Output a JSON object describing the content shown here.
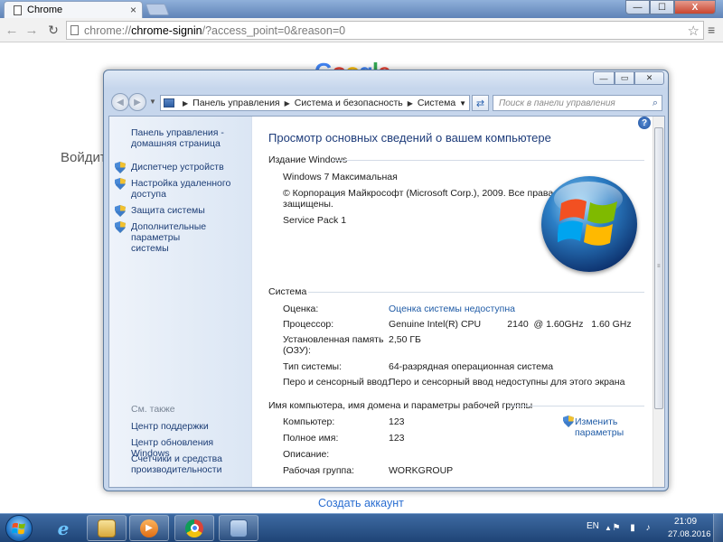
{
  "chrome": {
    "tab_title": "Chrome",
    "tab_close": "×",
    "url_scheme": "chrome://",
    "url_host": "chrome-signin",
    "url_rest": "/?access_point=0&reason=0",
    "min_glyph": "—",
    "max_glyph": "☐",
    "close_glyph": "X"
  },
  "page": {
    "signin_text": "Войдит",
    "create_account": "Создать аккаунт"
  },
  "sys_window": {
    "breadcrumb": [
      "Панель управления",
      "Система и безопасность",
      "Система"
    ],
    "search_placeholder": "Поиск в панели управления",
    "min_glyph": "—",
    "max_glyph": "▭",
    "close_glyph": "✕",
    "help_glyph": "?",
    "task_pane": {
      "home_link_line1": "Панель управления -",
      "home_link_line2": "домашняя страница",
      "links": [
        {
          "line1": "Диспетчер устройств",
          "line2": ""
        },
        {
          "line1": "Настройка удаленного",
          "line2": "доступа"
        },
        {
          "line1": "Защита системы",
          "line2": ""
        },
        {
          "line1": "Дополнительные параметры",
          "line2": "системы"
        }
      ],
      "see_also": "См. также",
      "see_also_links": [
        {
          "line1": "Центр поддержки",
          "line2": ""
        },
        {
          "line1": "Центр обновления Windows",
          "line2": ""
        },
        {
          "line1": "Счетчики и средства",
          "line2": "производительности"
        }
      ]
    },
    "main": {
      "title": "Просмотр основных сведений о вашем компьютере",
      "edition_head": "Издание Windows",
      "edition_name": "Windows 7 Максимальная",
      "copyright_line1": "© Корпорация Майкрософт (Microsoft Corp.), 2009. Все права",
      "copyright_line2": "защищены.",
      "service_pack": "Service Pack 1",
      "system_head": "Система",
      "system_rows": [
        {
          "label": "Оценка:",
          "value": "Оценка системы недоступна",
          "is_link": true
        },
        {
          "label": "Процессор:",
          "value": "Genuine Intel(R) CPU          2140  @ 1.60GHz   1.60 GHz",
          "is_link": false
        },
        {
          "label": "Установленная память",
          "label2": "(ОЗУ):",
          "value": "2,50 ГБ",
          "is_link": false
        },
        {
          "label": "Тип системы:",
          "value": "64-разрядная операционная система",
          "is_link": false
        },
        {
          "label": "Перо и сенсорный ввод:",
          "value": "Перо и сенсорный ввод недоступны для этого экрана",
          "is_link": false
        }
      ],
      "computer_head": "Имя компьютера, имя домена и параметры рабочей группы",
      "computer_rows": [
        {
          "label": "Компьютер:",
          "value": "123"
        },
        {
          "label": "Полное имя:",
          "value": "123"
        },
        {
          "label": "Описание:",
          "value": ""
        },
        {
          "label": "Рабочая группа:",
          "value": "WORKGROUP"
        }
      ],
      "change_link_line1": "Изменить",
      "change_link_line2": "параметры"
    }
  },
  "taskbar": {
    "language": "EN",
    "time": "21:09",
    "date": "27.08.2016"
  },
  "colors": {
    "link": "#1f5ba6",
    "title": "#1e3c7a",
    "taskbar": "#1f4476"
  }
}
